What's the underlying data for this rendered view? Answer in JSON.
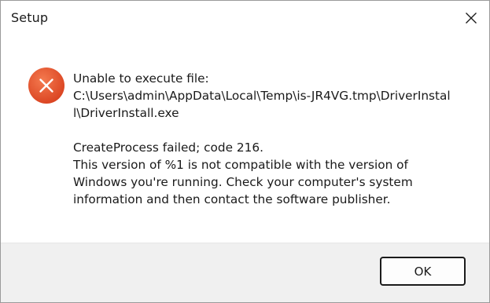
{
  "window": {
    "title": "Setup",
    "close_icon": "close-icon"
  },
  "dialog": {
    "icon": "error-icon",
    "icon_color": "#e2532d",
    "lines_group1": [
      "Unable to execute file:",
      "C:\\Users\\admin\\AppData\\Local\\Temp\\is-JR4VG.tmp\\DriverInstal",
      "l\\DriverInstall.exe"
    ],
    "lines_group2": [
      "CreateProcess failed; code 216.",
      "This version of %1 is not compatible with the version of",
      "Windows you're running. Check your computer's system",
      "information and then contact the software publisher."
    ]
  },
  "footer": {
    "ok_label": "OK"
  }
}
